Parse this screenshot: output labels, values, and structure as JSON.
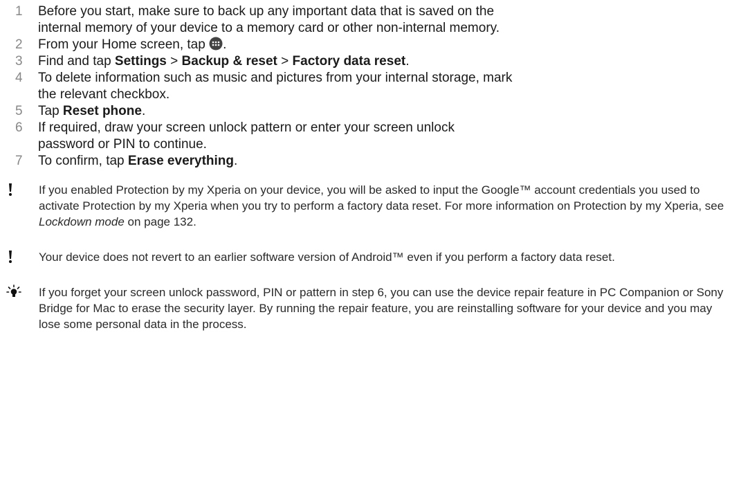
{
  "steps": [
    {
      "num": "1",
      "text": "Before you start, make sure to back up any important data that is saved on the internal memory of your device to a memory card or other non-internal memory."
    },
    {
      "num": "2",
      "pre": "From your Home screen, tap ",
      "post": ".",
      "icon": "apps-grid-icon"
    },
    {
      "num": "3",
      "pre": "Find and tap ",
      "b1": "Settings",
      "sep1": " > ",
      "b2": "Backup & reset",
      "sep2": " > ",
      "b3": "Factory data reset",
      "post": "."
    },
    {
      "num": "4",
      "text": "To delete information such as music and pictures from your internal storage, mark the relevant checkbox."
    },
    {
      "num": "5",
      "pre": "Tap ",
      "b1": "Reset phone",
      "post": "."
    },
    {
      "num": "6",
      "text": "If required, draw your screen unlock pattern or enter your screen unlock password or PIN to continue."
    },
    {
      "num": "7",
      "pre": "To confirm, tap ",
      "b1": "Erase everything",
      "post": "."
    }
  ],
  "notes": [
    {
      "icon": "exclamation-icon",
      "pre": "If you enabled Protection by my Xperia on your device, you will be asked to input the Google™ account credentials you used to activate Protection by my Xperia when you try to perform a factory data reset. For more information on Protection by my Xperia, see ",
      "link": "Lockdown mode",
      "post": " on page 132."
    },
    {
      "icon": "exclamation-icon",
      "text": "Your device does not revert to an earlier software version of Android™ even if you perform a factory data reset."
    },
    {
      "icon": "lightbulb-tip-icon",
      "text": "If you forget your screen unlock password, PIN or pattern in step 6, you can use the device repair feature in PC Companion or Sony Bridge for Mac to erase the security layer. By running the repair feature, you are reinstalling software for your device and you may lose some personal data in the process."
    }
  ]
}
